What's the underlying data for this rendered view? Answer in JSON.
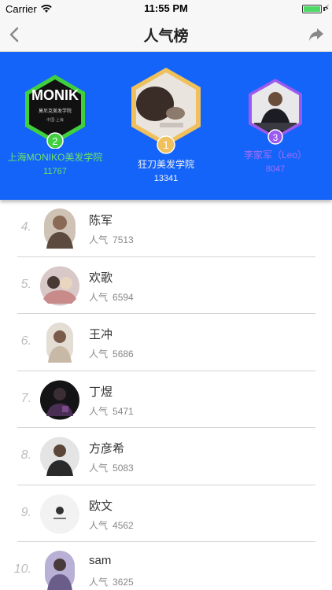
{
  "status_bar": {
    "carrier": "Carrier",
    "time": "11:55 PM"
  },
  "nav": {
    "title": "人气榜",
    "back_icon": "chevron-left-icon",
    "share_icon": "share-arrow-icon"
  },
  "podium": {
    "background": "#1564f9",
    "first": {
      "rank": "1",
      "name": "狂刀美发学院",
      "score": "13341",
      "frame_color": "#f0c05c"
    },
    "second": {
      "rank": "2",
      "name": "上海MONIKO美发学院",
      "score": "11767",
      "frame_color": "#3fcf3f",
      "logo_text": "MONIK",
      "logo_sub": "莫尼克美发学院",
      "logo_city": "中国·上海"
    },
    "third": {
      "rank": "3",
      "name": "李家军（Leo）",
      "score": "8047",
      "frame_color": "#9b59f0"
    }
  },
  "popularity_label": "人气",
  "list": [
    {
      "rank": "4.",
      "name": "陈军",
      "score": "7513"
    },
    {
      "rank": "5.",
      "name": "欢歌",
      "score": "6594"
    },
    {
      "rank": "6.",
      "name": "王冲",
      "score": "5686"
    },
    {
      "rank": "7.",
      "name": "丁煜",
      "score": "5471"
    },
    {
      "rank": "8.",
      "name": "方彦希",
      "score": "5083"
    },
    {
      "rank": "9.",
      "name": "欧文",
      "score": "4562"
    },
    {
      "rank": "10.",
      "name": "sam",
      "score": "3625"
    }
  ]
}
